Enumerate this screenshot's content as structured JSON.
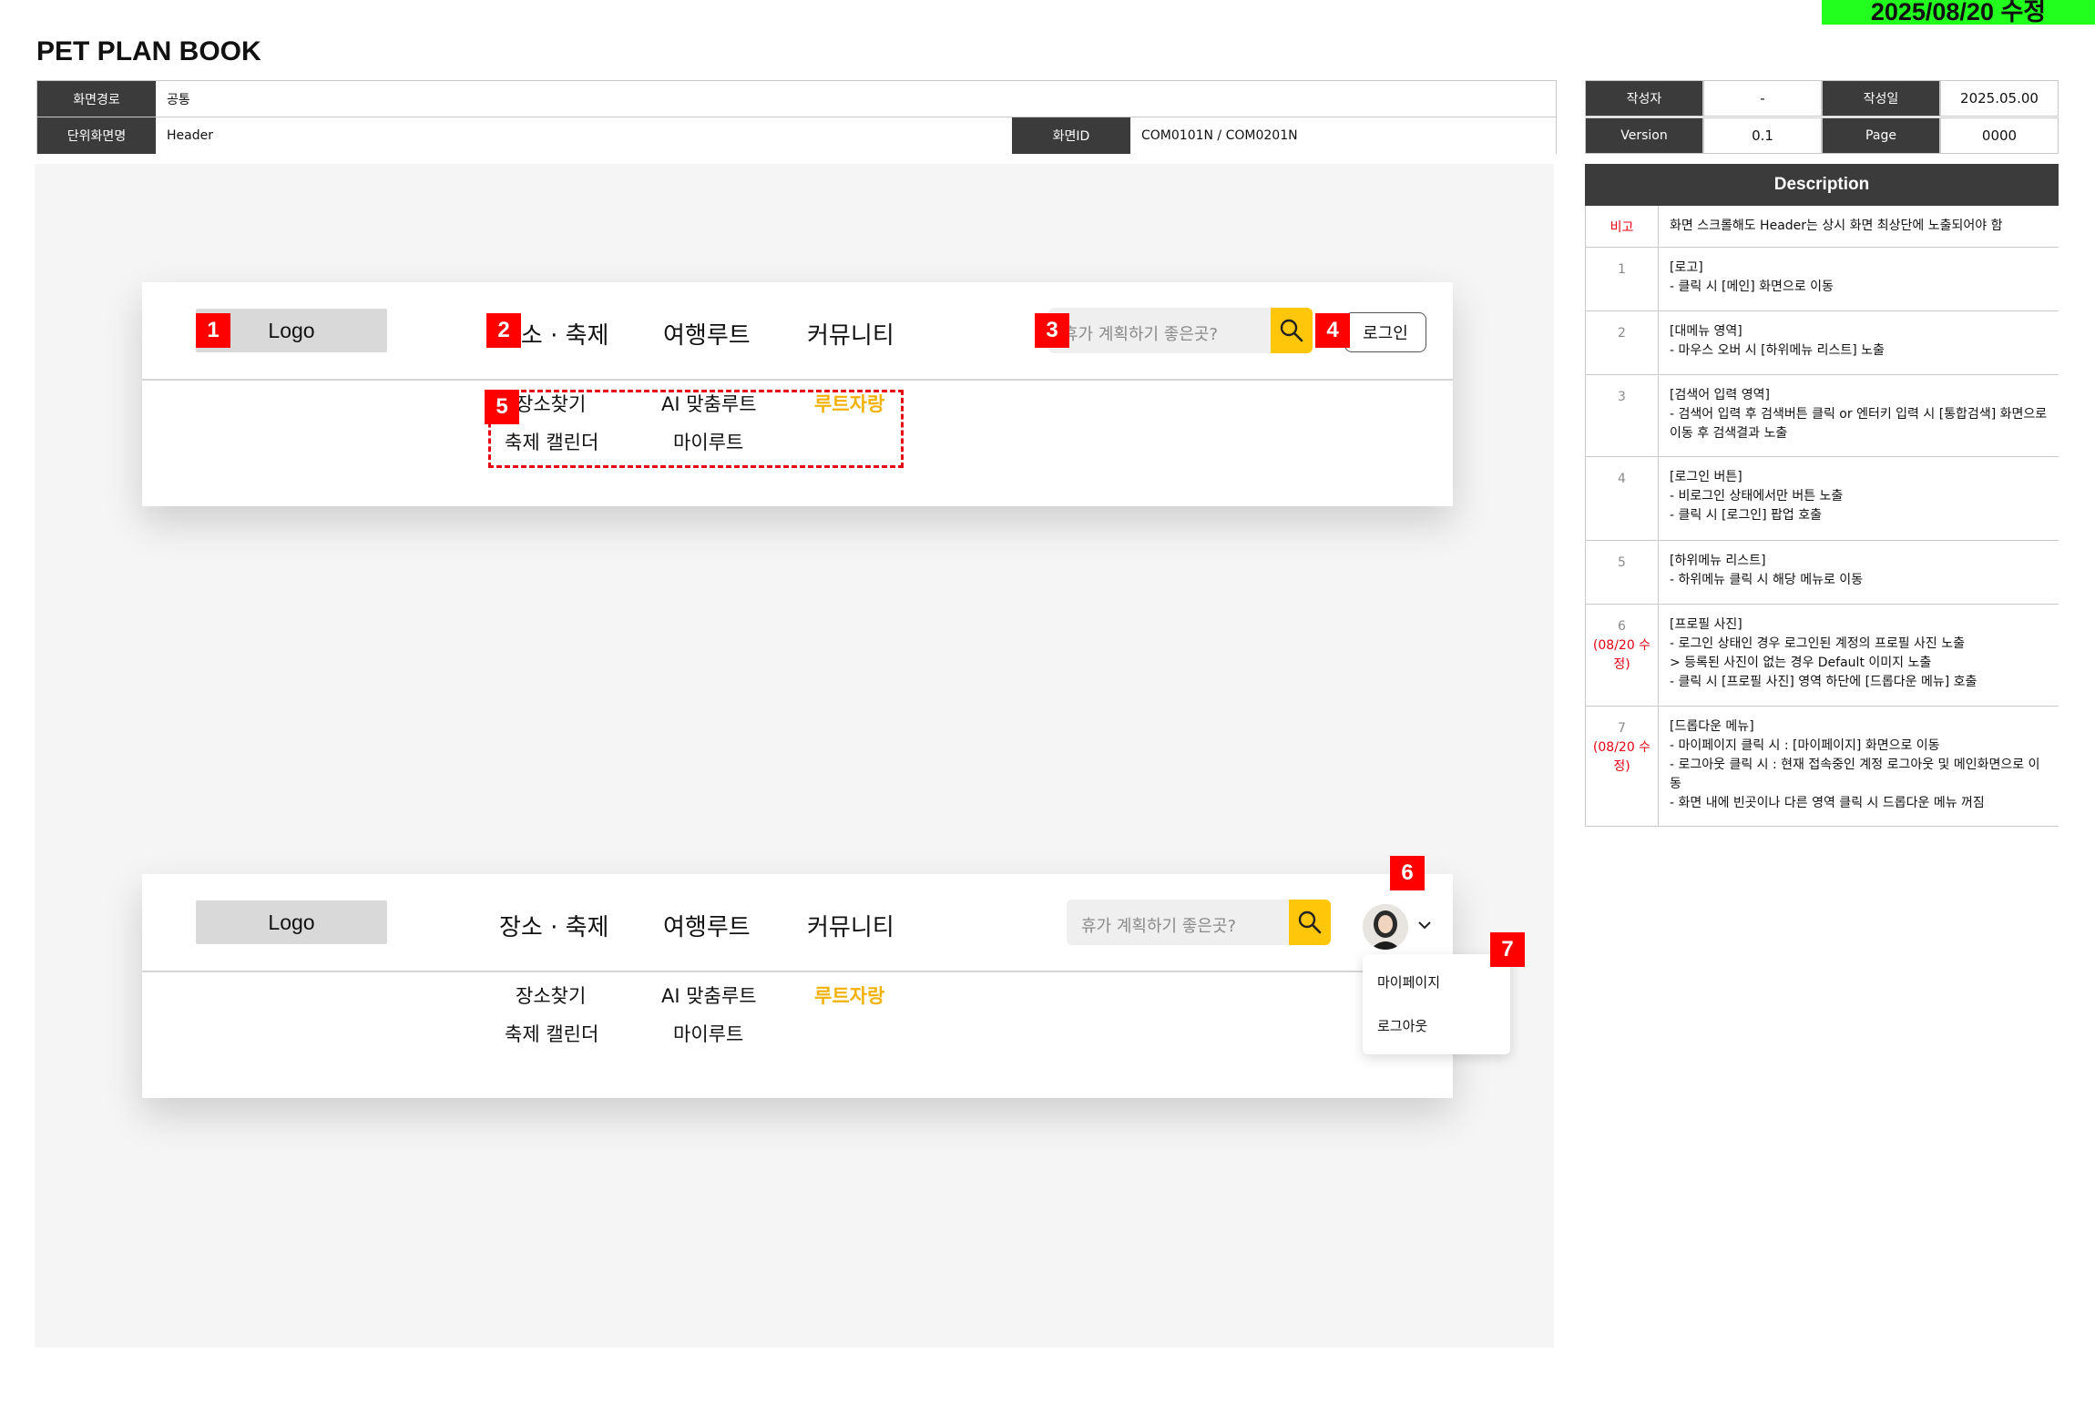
{
  "update_tag": "2025/08/20 수정",
  "doc_title": "PET PLAN BOOK",
  "info": {
    "path_label": "화면경로",
    "path_value": "공통",
    "unit_label": "단위화면명",
    "unit_value": "Header",
    "screen_id_label": "화면ID",
    "screen_id_value": "COM0101N / COM0201N"
  },
  "meta": {
    "author_label": "작성자",
    "author_value": "-",
    "date_label": "작성일",
    "date_value": "2025.05.00",
    "version_label": "Version",
    "version_value": "0.1",
    "page_label": "Page",
    "page_value": "0000"
  },
  "header": {
    "logo": "Logo",
    "menu": [
      "장소 · 축제",
      "여행루트",
      "커뮤니티"
    ],
    "search_placeholder": "휴가 계획하기 좋은곳?",
    "login": "로그인",
    "submenu": [
      "장소찾기",
      "AI 맞춤루트",
      "루트자랑",
      "축제 캘린더",
      "마이루트"
    ]
  },
  "dropdown": [
    "마이페이지",
    "로그아웃"
  ],
  "markers": [
    "1",
    "2",
    "3",
    "4",
    "5",
    "6",
    "7"
  ],
  "description": {
    "title": "Description",
    "rows": [
      {
        "no": "비고",
        "note": "",
        "text": "화면 스크롤해도 Header는 상시 화면 최상단에 노출되어야 함"
      },
      {
        "no": "1",
        "note": "",
        "text": "[로고]\n- 클릭 시 [메인] 화면으로 이동"
      },
      {
        "no": "2",
        "note": "",
        "text": "[대메뉴 영역]\n- 마우스 오버 시 [하위메뉴 리스트] 노출"
      },
      {
        "no": "3",
        "note": "",
        "text": "[검색어 입력 영역]\n- 검색어 입력 후 검색버튼 클릭 or 엔터키 입력 시 [통합검색] 화면으로 이동 후 검색결과 노출"
      },
      {
        "no": "4",
        "note": "",
        "text": "[로그인 버튼]\n- 비로그인 상태에서만 버튼 노출\n- 클릭 시 [로그인] 팝업 호출"
      },
      {
        "no": "5",
        "note": "",
        "text": "[하위메뉴 리스트]\n- 하위메뉴 클릭 시 해당 메뉴로 이동"
      },
      {
        "no": "6",
        "note": "(08/20 수정)",
        "text": "[프로필 사진]\n- 로그인 상태인 경우 로그인된 계정의 프로필 사진 노출\n  > 등록된 사진이 없는 경우 Default 이미지 노출\n- 클릭 시 [프로필 사진] 영역 하단에 [드롭다운 메뉴] 호출"
      },
      {
        "no": "7",
        "note": "(08/20 수정)",
        "text": "[드롭다운 메뉴]\n- 마이페이지 클릭 시 : [마이페이지] 화면으로 이동\n- 로그아웃 클릭 시 : 현재 접속중인 계정 로그아웃 및 메인화면으로 이동\n- 화면 내에 빈곳이나 다른 영역 클릭 시 드롭다운 메뉴 꺼짐"
      }
    ]
  }
}
